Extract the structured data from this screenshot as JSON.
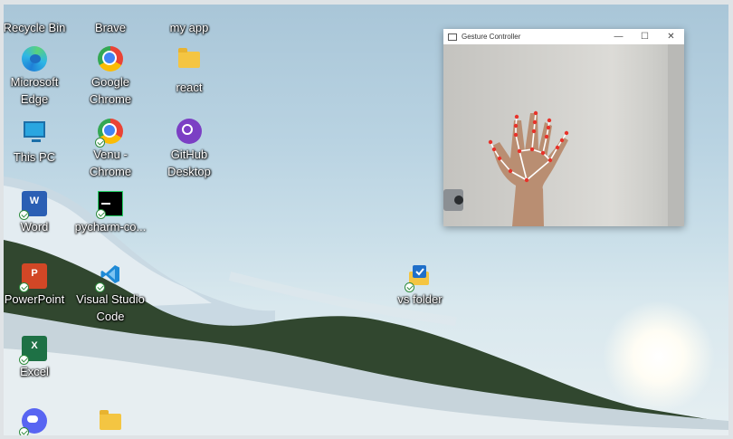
{
  "desktop": {
    "icons": [
      {
        "label": "Recycle Bin",
        "icon": "recycle-bin-icon"
      },
      {
        "label": "Brave",
        "icon": "brave-icon"
      },
      {
        "label": "my app",
        "icon": "folder-icon"
      },
      {
        "label": "Microsoft Edge",
        "icon": "edge-icon"
      },
      {
        "label": "Google Chrome",
        "icon": "chrome-icon"
      },
      {
        "label": "react",
        "icon": "folder-icon"
      },
      {
        "label": "This PC",
        "icon": "monitor-icon"
      },
      {
        "label": "Venu - Chrome",
        "icon": "chrome-icon"
      },
      {
        "label": "GitHub Desktop",
        "icon": "github-desktop-icon"
      },
      {
        "label": "Word",
        "icon": "word-icon"
      },
      {
        "label": "pycharm-co...",
        "icon": "pycharm-icon"
      },
      {
        "label": "PowerPoint",
        "icon": "powerpoint-icon"
      },
      {
        "label": "Visual Studio Code",
        "icon": "vscode-icon"
      },
      {
        "label": "vs folder",
        "icon": "vs-folder-icon"
      },
      {
        "label": "Excel",
        "icon": "excel-icon"
      },
      {
        "label": "",
        "icon": "discord-icon"
      },
      {
        "label": "",
        "icon": "folder-icon"
      }
    ]
  },
  "gesture_window": {
    "title": "Gesture Controller",
    "minimize": "—",
    "maximize": "☐",
    "close": "✕"
  },
  "colors": {
    "landmark_points": "#e8322a",
    "landmark_lines": "#ffffff"
  }
}
